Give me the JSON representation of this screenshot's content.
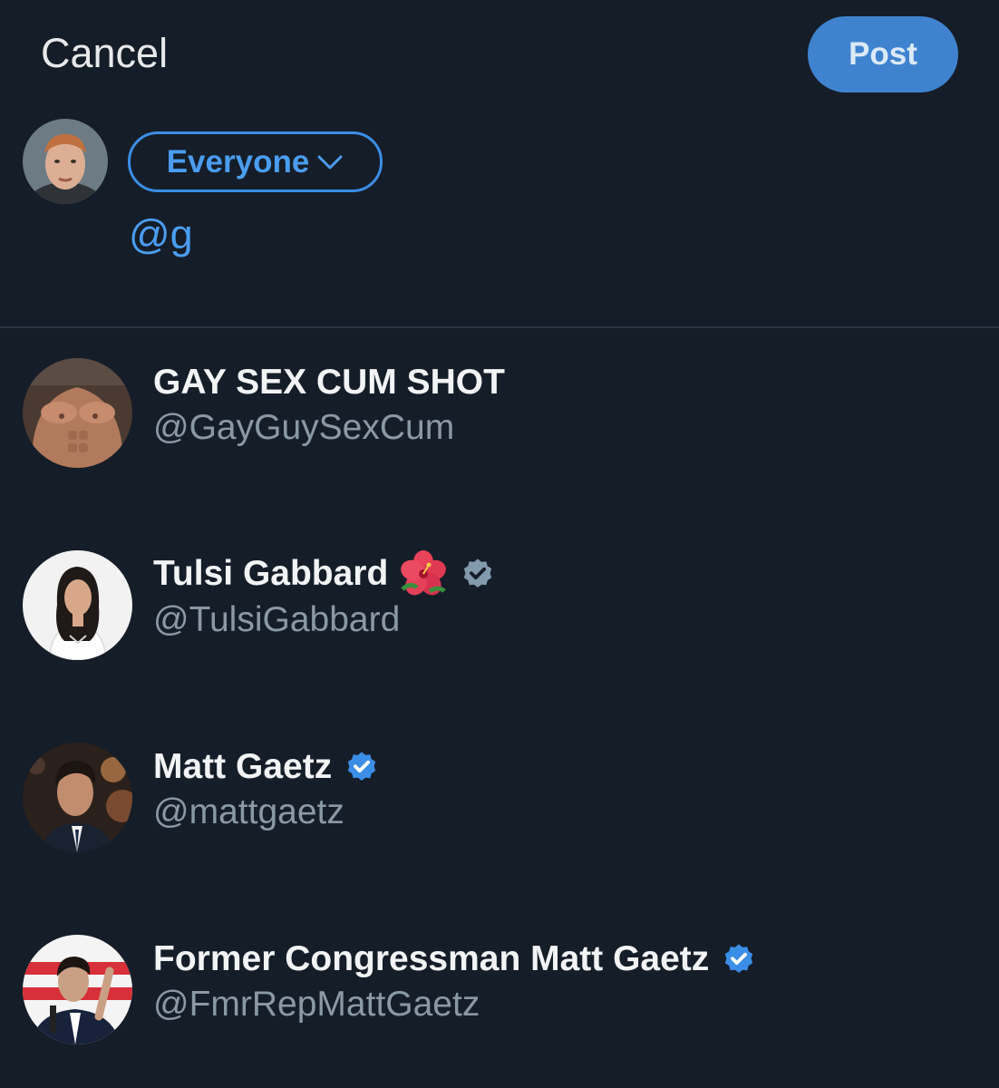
{
  "header": {
    "cancel_label": "Cancel",
    "post_label": "Post"
  },
  "composer": {
    "audience_label": "Everyone",
    "text": "@g"
  },
  "suggestions": [
    {
      "name": "GAY SEX CUM SHOT",
      "handle": "@GayGuySexCum",
      "badge": "none"
    },
    {
      "name": "Tulsi Gabbard",
      "handle": "@TulsiGabbard",
      "badge": "gray-verified-icon",
      "emoji": "hibiscus"
    },
    {
      "name": "Matt Gaetz",
      "handle": "@mattgaetz",
      "badge": "blue-verified-icon"
    },
    {
      "name": "Former Congressman Matt Gaetz",
      "handle": "@FmrRepMattGaetz",
      "badge": "blue-verified-icon"
    }
  ],
  "colors": {
    "background": "#151d28",
    "accent": "#3b8ee6",
    "post_button": "#3f83cf",
    "handle_gray": "#8b98a5",
    "verified_blue": "#3b8ee6",
    "verified_gray": "#829aab"
  }
}
